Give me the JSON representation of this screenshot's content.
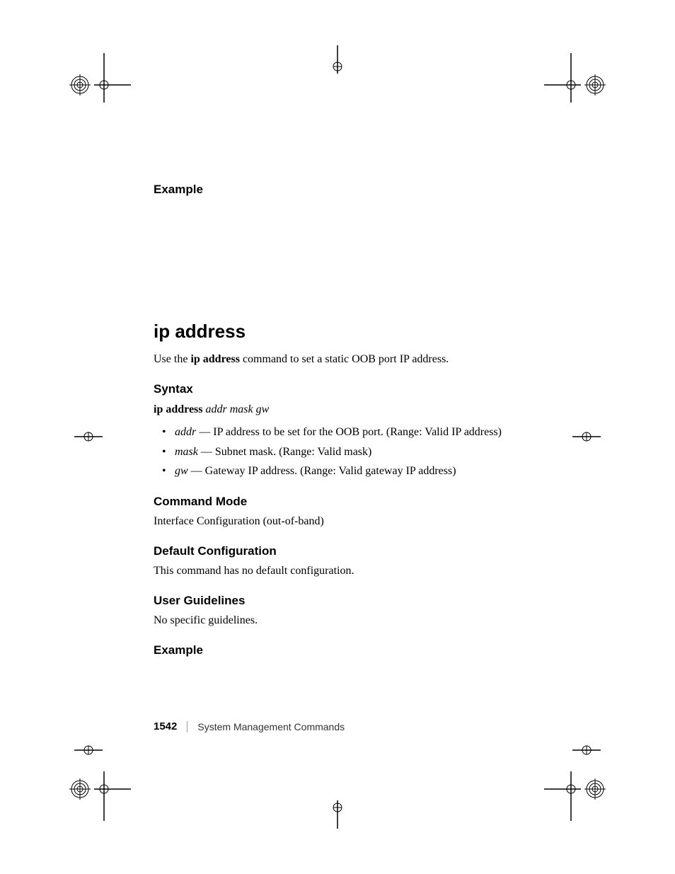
{
  "sections": {
    "example1_h": "Example",
    "title": "ip address",
    "intro_pre": "Use the ",
    "intro_bold": "ip address",
    "intro_post": " command to set a static OOB port IP address.",
    "syntax_h": "Syntax",
    "syntax_cmd": "ip address",
    "syntax_args": "addr mask gw",
    "params": [
      {
        "name": "addr",
        "desc": " — IP address to be set for the OOB port. (Range: Valid IP address)"
      },
      {
        "name": "mask",
        "desc": " — Subnet mask. (Range: Valid mask)"
      },
      {
        "name": "gw",
        "desc": " — Gateway IP address. (Range: Valid gateway IP address)"
      }
    ],
    "mode_h": "Command Mode",
    "mode_text": "Interface Configuration (out-of-band)",
    "default_h": "Default Configuration",
    "default_text": "This command has no default configuration.",
    "guide_h": "User Guidelines",
    "guide_text": "No specific guidelines.",
    "example2_h": "Example"
  },
  "footer": {
    "page": "1542",
    "section": "System Management Commands"
  }
}
